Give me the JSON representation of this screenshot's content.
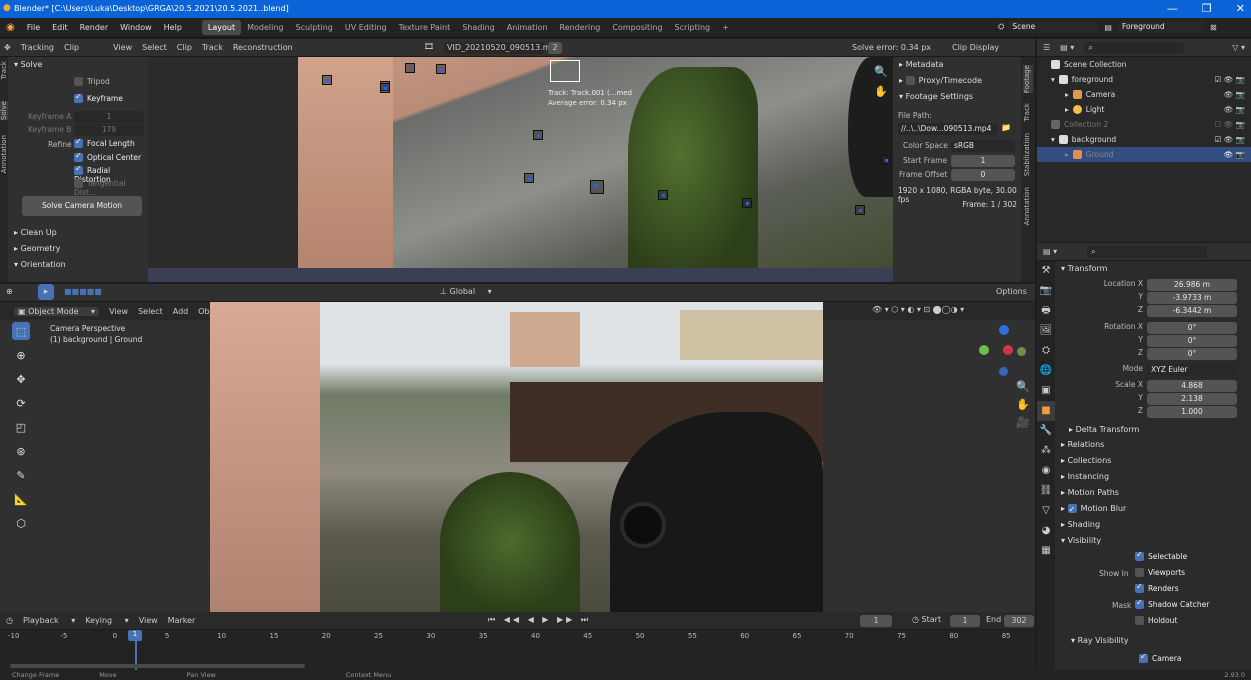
{
  "window": {
    "title": "Blender* [C:\\Users\\Luka\\Desktop\\GRGA\\20.5.2021\\20.5.2021..blend]"
  },
  "menu": [
    "File",
    "Edit",
    "Render",
    "Window",
    "Help"
  ],
  "workspaces": [
    {
      "label": "Layout",
      "active": true
    },
    {
      "label": "Modeling"
    },
    {
      "label": "Sculpting"
    },
    {
      "label": "UV Editing"
    },
    {
      "label": "Texture Paint"
    },
    {
      "label": "Shading"
    },
    {
      "label": "Animation"
    },
    {
      "label": "Rendering"
    },
    {
      "label": "Compositing"
    },
    {
      "label": "Scripting"
    }
  ],
  "scene": {
    "scene_name": "Scene",
    "layer_name": "Foreground"
  },
  "clip_header": {
    "mode": "Tracking",
    "view": "Clip",
    "menus": [
      "View",
      "Select",
      "Clip",
      "Track",
      "Reconstruction"
    ],
    "clip_name": "VID_20210520_090513.mp4",
    "clip_users": "2",
    "solve_error": "Solve error: 0.34 px",
    "display": "Clip Display"
  },
  "solve_panel": {
    "title": "Solve",
    "tripod": "Tripod",
    "keyframe": "Keyframe",
    "keyframe_a_label": "Keyframe A",
    "keyframe_a": "1",
    "keyframe_b_label": "Keyframe B",
    "keyframe_b": "179",
    "refine_label": "Refine",
    "focal_length": "Focal Length",
    "optical_center": "Optical Center",
    "radial_distortion": "Radial Distortion",
    "tangential": "Tangential Dist...",
    "solve_button": "Solve Camera Motion",
    "clean_up": "Clean Up",
    "geometry": "Geometry",
    "orientation": "Orientation",
    "vtabs": [
      "Track",
      "Solve",
      "Annotation"
    ]
  },
  "footage_panel": {
    "metadata": "Metadata",
    "proxy": "Proxy/Timecode",
    "settings": "Footage Settings",
    "file_path_label": "File Path:",
    "file_path": "//..\\..\\Dow...090513.mp4",
    "color_space_label": "Color Space",
    "color_space": "sRGB",
    "start_frame_label": "Start Frame",
    "start_frame": "1",
    "frame_offset_label": "Frame Offset",
    "frame_offset": "0",
    "info": "1920 x 1080, RGBA byte, 30.00 fps",
    "frame_info": "Frame: 1 / 302",
    "vtabs": [
      "Footage",
      "Track",
      "Stabilization",
      "Annotation"
    ]
  },
  "tracking_overlay": {
    "line1": "Track: Track.001 (...med",
    "line2": "Average error: 0.34 px"
  },
  "viewport_header": {
    "mode": "Object Mode",
    "menus": [
      "View",
      "Select",
      "Add",
      "Object"
    ],
    "orientation": "Global",
    "options": "Options"
  },
  "viewport": {
    "camera_label": "Camera Perspective",
    "object_label": "(1) background | Ground"
  },
  "outliner": {
    "title": "Scene Collection",
    "items": [
      {
        "label": "foreground",
        "depth": 0
      },
      {
        "label": "Camera",
        "depth": 1
      },
      {
        "label": "Light",
        "depth": 1
      },
      {
        "label": "Collection 2",
        "depth": 0
      },
      {
        "label": "background",
        "depth": 0
      },
      {
        "label": "Ground",
        "depth": 1,
        "selected": true
      }
    ]
  },
  "properties": {
    "transform_title": "Transform",
    "location_label": "Location X",
    "loc_x": "26.986 m",
    "loc_y": "-3.9733 m",
    "loc_z": "-6.3442 m",
    "rotation_label": "Rotation X",
    "rot_x": "0°",
    "rot_y": "0°",
    "rot_z": "0°",
    "mode_label": "Mode",
    "mode": "XYZ Euler",
    "scale_label": "Scale X",
    "scale_x": "4.868",
    "scale_y": "2.138",
    "scale_z": "1.000",
    "y": "Y",
    "z": "Z",
    "sections": [
      "Delta Transform",
      "Relations",
      "Collections",
      "Instancing",
      "Motion Paths",
      "Motion Blur",
      "Shading",
      "Visibility"
    ],
    "selectable": "Selectable",
    "show_in": "Show In",
    "viewports": "Viewports",
    "renders": "Renders",
    "mask": "Mask",
    "shadow_catcher": "Shadow Catcher",
    "holdout": "Holdout",
    "ray_visibility": "Ray Visibility",
    "camera": "Camera"
  },
  "timeline": {
    "menus": [
      "Playback",
      "Keying",
      "View",
      "Marker"
    ],
    "current_frame": "1",
    "start_label": "Start",
    "start": "1",
    "end_label": "End",
    "end": "302",
    "ticks": [
      "-10",
      "-5",
      "0",
      "5",
      "10",
      "15",
      "20",
      "25",
      "30",
      "35",
      "40",
      "45",
      "50",
      "55",
      "60",
      "65",
      "70",
      "75",
      "80",
      "85"
    ]
  },
  "statusbar": {
    "items": [
      "Change Frame",
      "Move",
      "Pan View",
      "Context Menu"
    ],
    "version": "2.93.0"
  },
  "colors": {
    "accent": "#4772b3",
    "titlebar": "#0a64d8",
    "panel": "#303030"
  }
}
